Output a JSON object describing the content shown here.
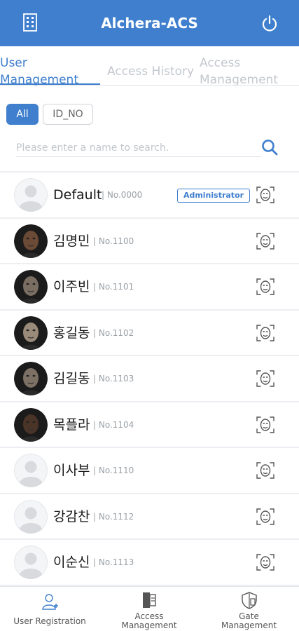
{
  "header": {
    "title": "Alchera-ACS",
    "left_icon": "building-icon",
    "right_icon": "power-icon",
    "color": "#3f7fcd"
  },
  "tabs": [
    {
      "label_line1": "User",
      "label_line2": "Management",
      "active": true
    },
    {
      "label": "Access History",
      "active": false
    },
    {
      "label_line1": "Access",
      "label_line2": "Management",
      "active": false
    }
  ],
  "filters": [
    {
      "label": "All",
      "selected": true
    },
    {
      "label": "ID_NO",
      "selected": false
    }
  ],
  "search": {
    "placeholder": "Please enter a name to search.",
    "value": "",
    "icon": "search-icon"
  },
  "users": [
    {
      "name": "Default",
      "number": "| No.0000",
      "badge": "Administrator",
      "photo": "placeholder"
    },
    {
      "name": "김명민",
      "number": "| No.1100",
      "photo": "portrait"
    },
    {
      "name": "이주빈",
      "number": "| No.1101",
      "photo": "portrait"
    },
    {
      "name": "홍길동",
      "number": "| No.1102",
      "photo": "portrait"
    },
    {
      "name": "김길동",
      "number": "| No.1103",
      "photo": "portrait"
    },
    {
      "name": "목플라",
      "number": "| No.1104",
      "photo": "portrait"
    },
    {
      "name": "이사부",
      "number": "| No.1110",
      "photo": "placeholder"
    },
    {
      "name": "강감찬",
      "number": "| No.1112",
      "photo": "placeholder"
    },
    {
      "name": "이순신",
      "number": "| No.1113",
      "photo": "placeholder"
    }
  ],
  "bottom_nav": [
    {
      "label": "User Registration",
      "icon": "user-add-icon"
    },
    {
      "label_line1": "Access",
      "label_line2": "Management",
      "icon": "door-icon"
    },
    {
      "label_line1": "Gate",
      "label_line2": "Management",
      "icon": "shield-icon"
    }
  ]
}
